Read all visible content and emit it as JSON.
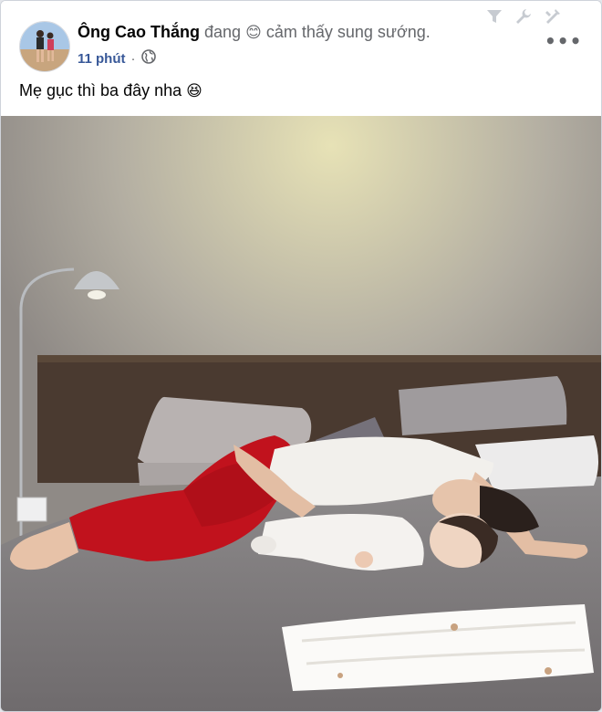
{
  "post": {
    "author": "Ông Cao Thắng",
    "status_verb": "đang",
    "feeling_emoji": "😊",
    "feeling_text": "cảm thấy sung sướng.",
    "time": "11 phút",
    "separator": "·",
    "privacy_icon": "globe-icon",
    "more_label": "•••",
    "caption_text": "Mẹ gục thì ba đây nha",
    "caption_emoji": "😆",
    "photo_alt": "Người mẹ mặc quần đỏ áo trắng ngủ gục trên giường cạnh em bé mặc đồ trắng"
  },
  "toolbar_icons": [
    "filter-icon",
    "wrench-icon",
    "tools-icon"
  ]
}
